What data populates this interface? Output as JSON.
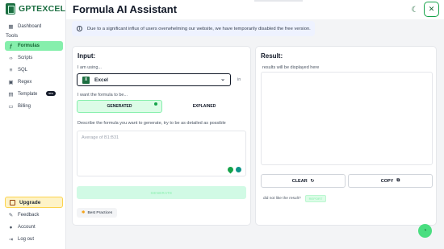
{
  "app": {
    "logo_text": "GPTEXCEL"
  },
  "sidebar": {
    "dashboard": "Dashboard",
    "section_tools": "Tools",
    "items": [
      {
        "label": "Formulas",
        "icon": "formula-icon",
        "active": true
      },
      {
        "label": "Scripts",
        "icon": "code-icon",
        "active": false
      },
      {
        "label": "SQL",
        "icon": "database-icon",
        "active": false
      },
      {
        "label": "Regex",
        "icon": "regex-icon",
        "active": false
      },
      {
        "label": "Template",
        "icon": "template-icon",
        "active": false,
        "badge": "new"
      },
      {
        "label": "Billing",
        "icon": "billing-icon",
        "active": false
      }
    ],
    "upgrade": "Upgrade",
    "feedback": "Feedback",
    "account": "Account",
    "logout": "Log out"
  },
  "header": {
    "title": "Formula AI Assistant"
  },
  "notice": {
    "text": "Due to a significant influx of users overwhelming our website, we have temporarily disabled the free version."
  },
  "input_panel": {
    "title": "Input:",
    "using_label": "I am using...",
    "selected_app": "Excel",
    "in_label": "in",
    "want_label": "I want the formula to be...",
    "toggle": [
      "GENERATED",
      "EXPLAINED"
    ],
    "describe_label": "Describe the formula you want to generate, try to be as detailed as possible",
    "textarea_placeholder": "Average of B1:B31",
    "generate_button": "GENERATE",
    "best_practices": "Best Practices"
  },
  "result_panel": {
    "title": "Result:",
    "placeholder": "results will be displayed here",
    "clear_button": "CLEAR",
    "copy_button": "COPY",
    "dislike_text": "did not like the result?",
    "report_button": "REPORT"
  },
  "colors": {
    "accent": "#16a34a",
    "accent_light": "#86efac",
    "brand": "#1d6f42"
  }
}
